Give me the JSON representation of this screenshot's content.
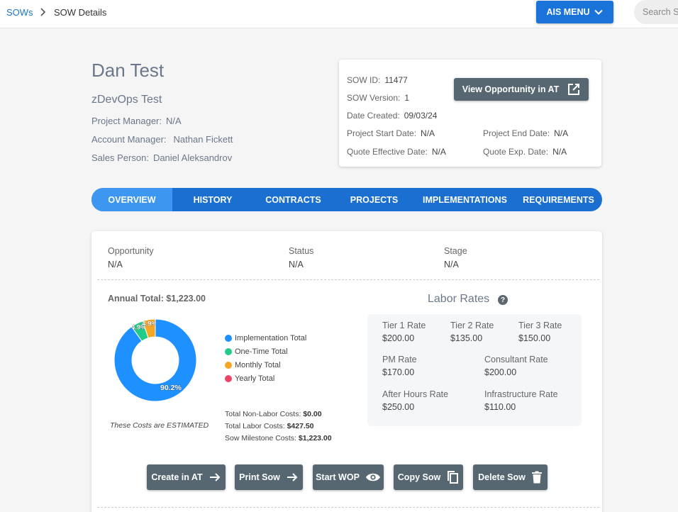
{
  "breadcrumb": {
    "root": "SOWs",
    "current": "SOW Details"
  },
  "header": {
    "menu_label": "AIS MENU",
    "search_placeholder": "Search S"
  },
  "profile": {
    "name": "Dan Test",
    "company": "zDevOps Test",
    "project_manager_label": "Project Manager:",
    "project_manager": "N/A",
    "account_manager_label": "Account Manager:",
    "account_manager": "Nathan Fickett",
    "sales_person_label": "Sales Person:",
    "sales_person": "Daniel Aleksandrov"
  },
  "sow": {
    "id_label": "SOW ID:",
    "id": "11477",
    "version_label": "SOW Version:",
    "version": "1",
    "date_created_label": "Date Created:",
    "date_created": "09/03/24",
    "start_label": "Project Start Date:",
    "start": "N/A",
    "end_label": "Project End Date:",
    "end": "N/A",
    "quote_eff_label": "Quote Effective Date:",
    "quote_eff": "N/A",
    "quote_exp_label": "Quote Exp. Date:",
    "quote_exp": "N/A",
    "view_button": "View Opportunity in AT"
  },
  "tabs": [
    "OVERVIEW",
    "HISTORY",
    "CONTRACTS",
    "PROJECTS",
    "IMPLEMENTATIONS",
    "REQUIREMENTS"
  ],
  "overview": {
    "opportunity_label": "Opportunity",
    "opportunity": "N/A",
    "status_label": "Status",
    "status": "N/A",
    "stage_label": "Stage",
    "stage": "N/A",
    "annual_total": "Annual Total: $1,223.00",
    "estimated_note": "These Costs are ESTIMATED",
    "non_labor_label": "Total Non-Labor Costs:",
    "non_labor": "$0.00",
    "labor_label": "Total Labor Costs:",
    "labor": "$427.50",
    "milestone_label": "Sow Milestone Costs:",
    "milestone": "$1,223.00"
  },
  "chart_data": {
    "type": "pie",
    "categories": [
      "Implementation Total",
      "One-Time Total",
      "Monthly Total",
      "Yearly Total"
    ],
    "values": [
      90.2,
      4.9,
      4.9,
      0
    ],
    "labels": [
      "90.2%",
      "4.9%",
      "4.9%",
      ""
    ],
    "colors": [
      "#1e90ff",
      "#22cc88",
      "#f5a623",
      "#ee4466"
    ]
  },
  "labor_rates": {
    "title": "Labor Rates",
    "help": "?",
    "rates": [
      {
        "label": "Tier 1 Rate",
        "value": "$200.00"
      },
      {
        "label": "Tier 2 Rate",
        "value": "$135.00"
      },
      {
        "label": "Tier 3 Rate",
        "value": "$150.00"
      },
      {
        "label": "PM Rate",
        "value": "$170.00"
      },
      {
        "label": "Consultant Rate",
        "value": "$200.00"
      },
      {
        "label": "After Hours Rate",
        "value": "$250.00"
      },
      {
        "label": "Infrastructure Rate",
        "value": "$110.00"
      }
    ]
  },
  "actions": {
    "create": "Create in AT",
    "print": "Print Sow",
    "start_wop": "Start WOP",
    "copy": "Copy Sow",
    "delete": "Delete Sow"
  }
}
